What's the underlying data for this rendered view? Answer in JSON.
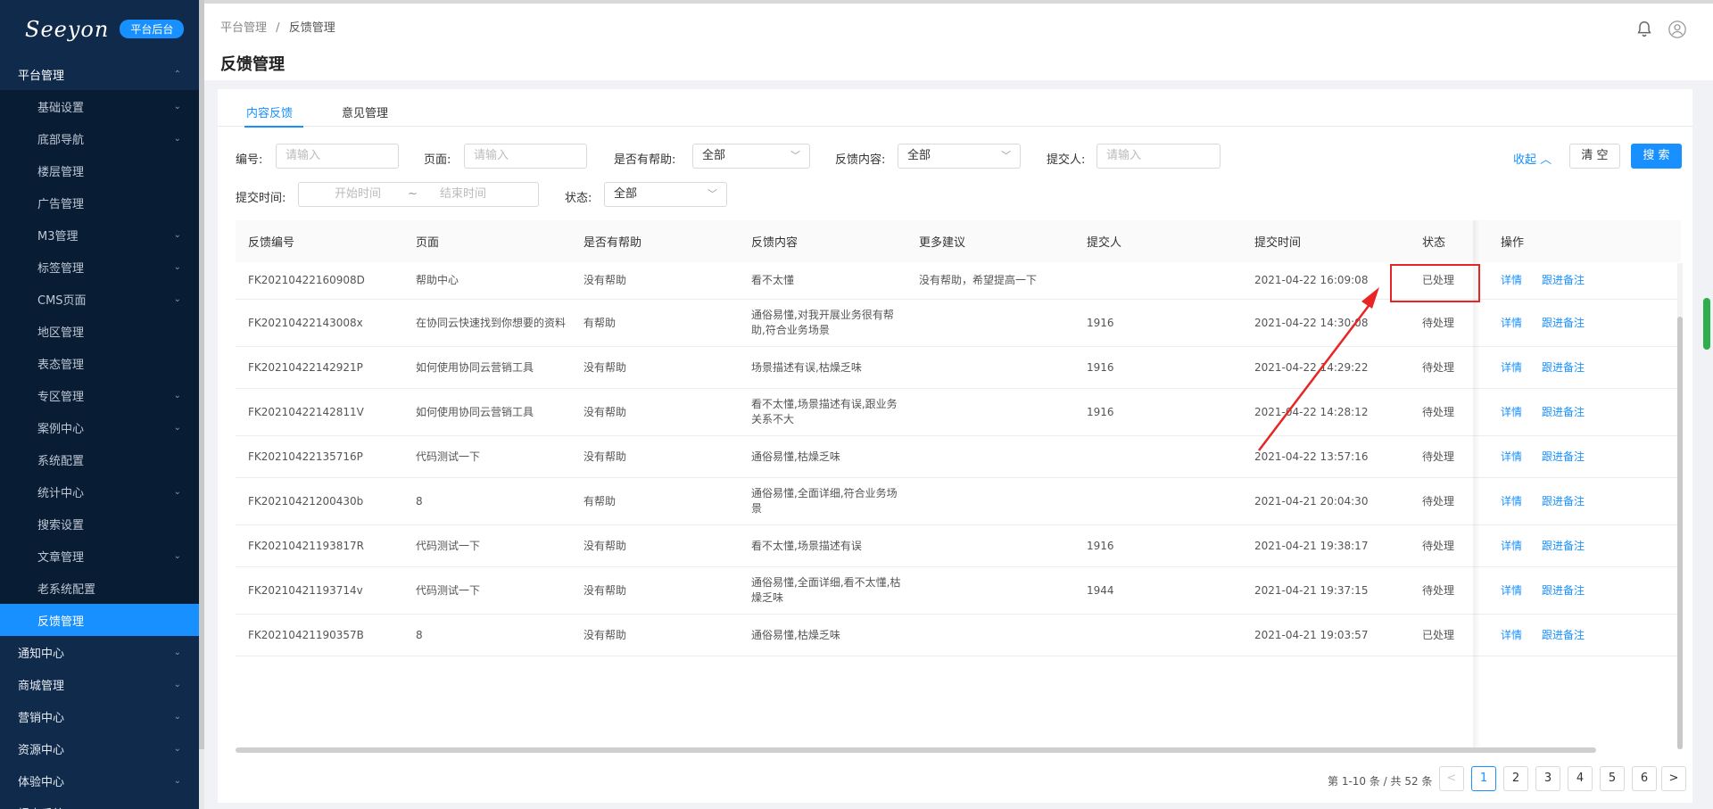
{
  "sidebar": {
    "logo": "Seeyon",
    "badge": "平台后台",
    "top_group": "平台管理",
    "items": [
      {
        "label": "基础设置",
        "chev": true
      },
      {
        "label": "底部导航",
        "chev": true
      },
      {
        "label": "楼层管理",
        "chev": false
      },
      {
        "label": "广告管理",
        "chev": false
      },
      {
        "label": "M3管理",
        "chev": true
      },
      {
        "label": "标签管理",
        "chev": true
      },
      {
        "label": "CMS页面",
        "chev": true
      },
      {
        "label": "地区管理",
        "chev": false
      },
      {
        "label": "表态管理",
        "chev": false
      },
      {
        "label": "专区管理",
        "chev": true
      },
      {
        "label": "案例中心",
        "chev": true
      },
      {
        "label": "系统配置",
        "chev": false
      },
      {
        "label": "统计中心",
        "chev": true
      },
      {
        "label": "搜索设置",
        "chev": false
      },
      {
        "label": "文章管理",
        "chev": true
      },
      {
        "label": "老系统配置",
        "chev": false
      },
      {
        "label": "反馈管理",
        "chev": false,
        "active": true
      }
    ],
    "groups": [
      {
        "label": "通知中心"
      },
      {
        "label": "商城管理"
      },
      {
        "label": "营销中心"
      },
      {
        "label": "资源中心"
      },
      {
        "label": "体验中心"
      },
      {
        "label": "报表系统"
      }
    ]
  },
  "header": {
    "breadcrumb": [
      "平台管理",
      "反馈管理"
    ],
    "breadcrumb_sep": "/",
    "title": "反馈管理"
  },
  "tabs": [
    {
      "label": "内容反馈",
      "active": true
    },
    {
      "label": "意见管理",
      "active": false
    }
  ],
  "filters": {
    "id_label": "编号:",
    "id_placeholder": "请输入",
    "page_label": "页面:",
    "page_placeholder": "请输入",
    "helpful_label": "是否有帮助:",
    "helpful_value": "全部",
    "content_label": "反馈内容:",
    "content_value": "全部",
    "submitter_label": "提交人:",
    "submitter_placeholder": "请输入",
    "time_label": "提交时间:",
    "time_start": "开始时间",
    "time_sep": "~",
    "time_end": "结束时间",
    "status_label": "状态:",
    "status_value": "全部",
    "collapse_label": "收起",
    "clear_label": "清 空",
    "search_label": "搜 索"
  },
  "table": {
    "columns": [
      "反馈编号",
      "页面",
      "是否有帮助",
      "反馈内容",
      "更多建议",
      "提交人",
      "提交时间",
      "状态",
      "操作"
    ],
    "rows": [
      {
        "id": "FK20210422160908D",
        "page": "帮助中心",
        "helpful": "没有帮助",
        "content": "看不太懂",
        "suggestion": "没有帮助，希望提高一下",
        "submitter": "",
        "time": "2021-04-22 16:09:08",
        "status": "已处理"
      },
      {
        "id": "FK20210422143008x",
        "page": "在协同云快速找到你想要的资料",
        "helpful": "有帮助",
        "content": "通俗易懂,对我开展业务很有帮助,符合业务场景",
        "suggestion": "",
        "submitter": "1916",
        "time": "2021-04-22 14:30:08",
        "status": "待处理"
      },
      {
        "id": "FK20210422142921P",
        "page": "如何使用协同云营销工具",
        "helpful": "没有帮助",
        "content": "场景描述有误,枯燥乏味",
        "suggestion": "",
        "submitter": "1916",
        "time": "2021-04-22 14:29:22",
        "status": "待处理"
      },
      {
        "id": "FK20210422142811V",
        "page": "如何使用协同云营销工具",
        "helpful": "没有帮助",
        "content": "看不太懂,场景描述有误,跟业务关系不大",
        "suggestion": "",
        "submitter": "1916",
        "time": "2021-04-22 14:28:12",
        "status": "待处理"
      },
      {
        "id": "FK20210422135716P",
        "page": "代码测试一下",
        "helpful": "没有帮助",
        "content": "通俗易懂,枯燥乏味",
        "suggestion": "",
        "submitter": "",
        "time": "2021-04-22 13:57:16",
        "status": "待处理"
      },
      {
        "id": "FK20210421200430b",
        "page": "8",
        "helpful": "有帮助",
        "content": "通俗易懂,全面详细,符合业务场景",
        "suggestion": "",
        "submitter": "",
        "time": "2021-04-21 20:04:30",
        "status": "待处理"
      },
      {
        "id": "FK20210421193817R",
        "page": "代码测试一下",
        "helpful": "没有帮助",
        "content": "看不太懂,场景描述有误",
        "suggestion": "",
        "submitter": "1916",
        "time": "2021-04-21 19:38:17",
        "status": "待处理"
      },
      {
        "id": "FK20210421193714v",
        "page": "代码测试一下",
        "helpful": "没有帮助",
        "content": "通俗易懂,全面详细,看不太懂,枯燥乏味",
        "suggestion": "",
        "submitter": "1944",
        "time": "2021-04-21 19:37:15",
        "status": "待处理"
      },
      {
        "id": "FK20210421190357B",
        "page": "8",
        "helpful": "没有帮助",
        "content": "通俗易懂,枯燥乏味",
        "suggestion": "",
        "submitter": "",
        "time": "2021-04-21 19:03:57",
        "status": "已处理"
      }
    ],
    "action_detail": "详情",
    "action_followup": "跟进备注"
  },
  "pagination": {
    "info": "第 1-10 条 / 共 52 条",
    "pages": [
      "1",
      "2",
      "3",
      "4",
      "5",
      "6"
    ],
    "current": "1",
    "prev": "<",
    "next": ">"
  },
  "colors": {
    "sidebar_bg": "#0f2a4a",
    "accent": "#1890ff",
    "annotation": "#e82424"
  }
}
